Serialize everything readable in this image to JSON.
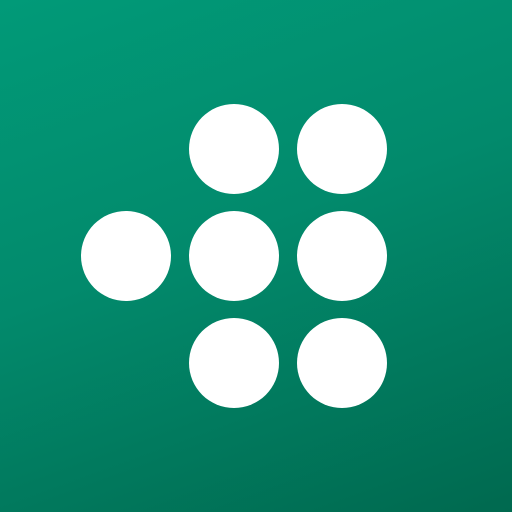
{
  "icon": {
    "name": "seven-dot-grid-logo",
    "colors": {
      "background_top": "#019a78",
      "background_mid": "#028a6c",
      "background_bottom": "#00694f",
      "dot": "#ffffff"
    },
    "dot_count": 7,
    "rows": [
      [
        false,
        true,
        true
      ],
      [
        true,
        true,
        true
      ],
      [
        false,
        true,
        true
      ]
    ]
  }
}
